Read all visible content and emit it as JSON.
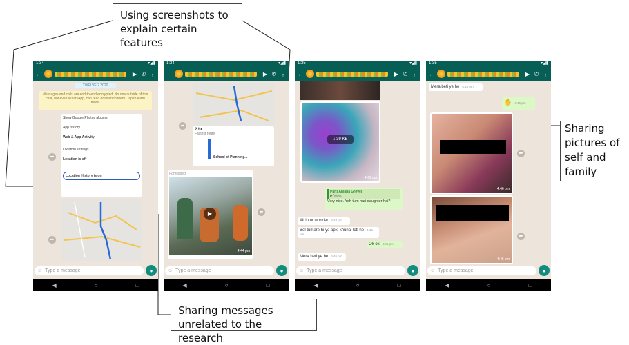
{
  "callouts": {
    "top": "Using screenshots to explain certain features",
    "bottom": "Sharing messages unrelated to the research",
    "right": "Sharing pictures of self and family"
  },
  "phones": [
    {
      "time": "1:34",
      "label_date": "TWELVE 2 2020",
      "notice": "Messages and calls are end-to-end encrypted. No one outside of this chat, not even WhatsApp, can read or listen to them. Tap to learn more.",
      "settings_lines": [
        "Show Google Photos albums",
        "App history",
        "Web & App Activity",
        "Location settings",
        "Location is off",
        "Location History is on"
      ],
      "input_placeholder": "Type a message"
    },
    {
      "time": "1:34",
      "route_time": "2 hr",
      "route_label": "Fastest route",
      "forwarded": "Forwarded",
      "dest": "School of Planning...",
      "time_stamp": "4:44 pm",
      "input_placeholder": "Type a message"
    },
    {
      "time": "1:35",
      "video_size": "39 KB",
      "sender": "Parti Anjana Grover",
      "msg1": "Very nice. Yeh tum hari daughter hai?",
      "msg2": "All in ur wonder",
      "msg3": "Bol tumare hi ye apki khunai lotl he",
      "msg4": "Ok ok",
      "msg5": "Mera beti ye he",
      "t1": "4:42 pm",
      "t2": "4:44 pm",
      "t3": "4:45 pm",
      "t4": "4:46 pm",
      "input_placeholder": "Type a message"
    },
    {
      "time": "1:35",
      "msg1": "Mera beti ye he",
      "t1": "4:45 pm",
      "t2": "4:46 pm",
      "t3": "4:46 pm",
      "input_placeholder": "Type a message"
    }
  ]
}
